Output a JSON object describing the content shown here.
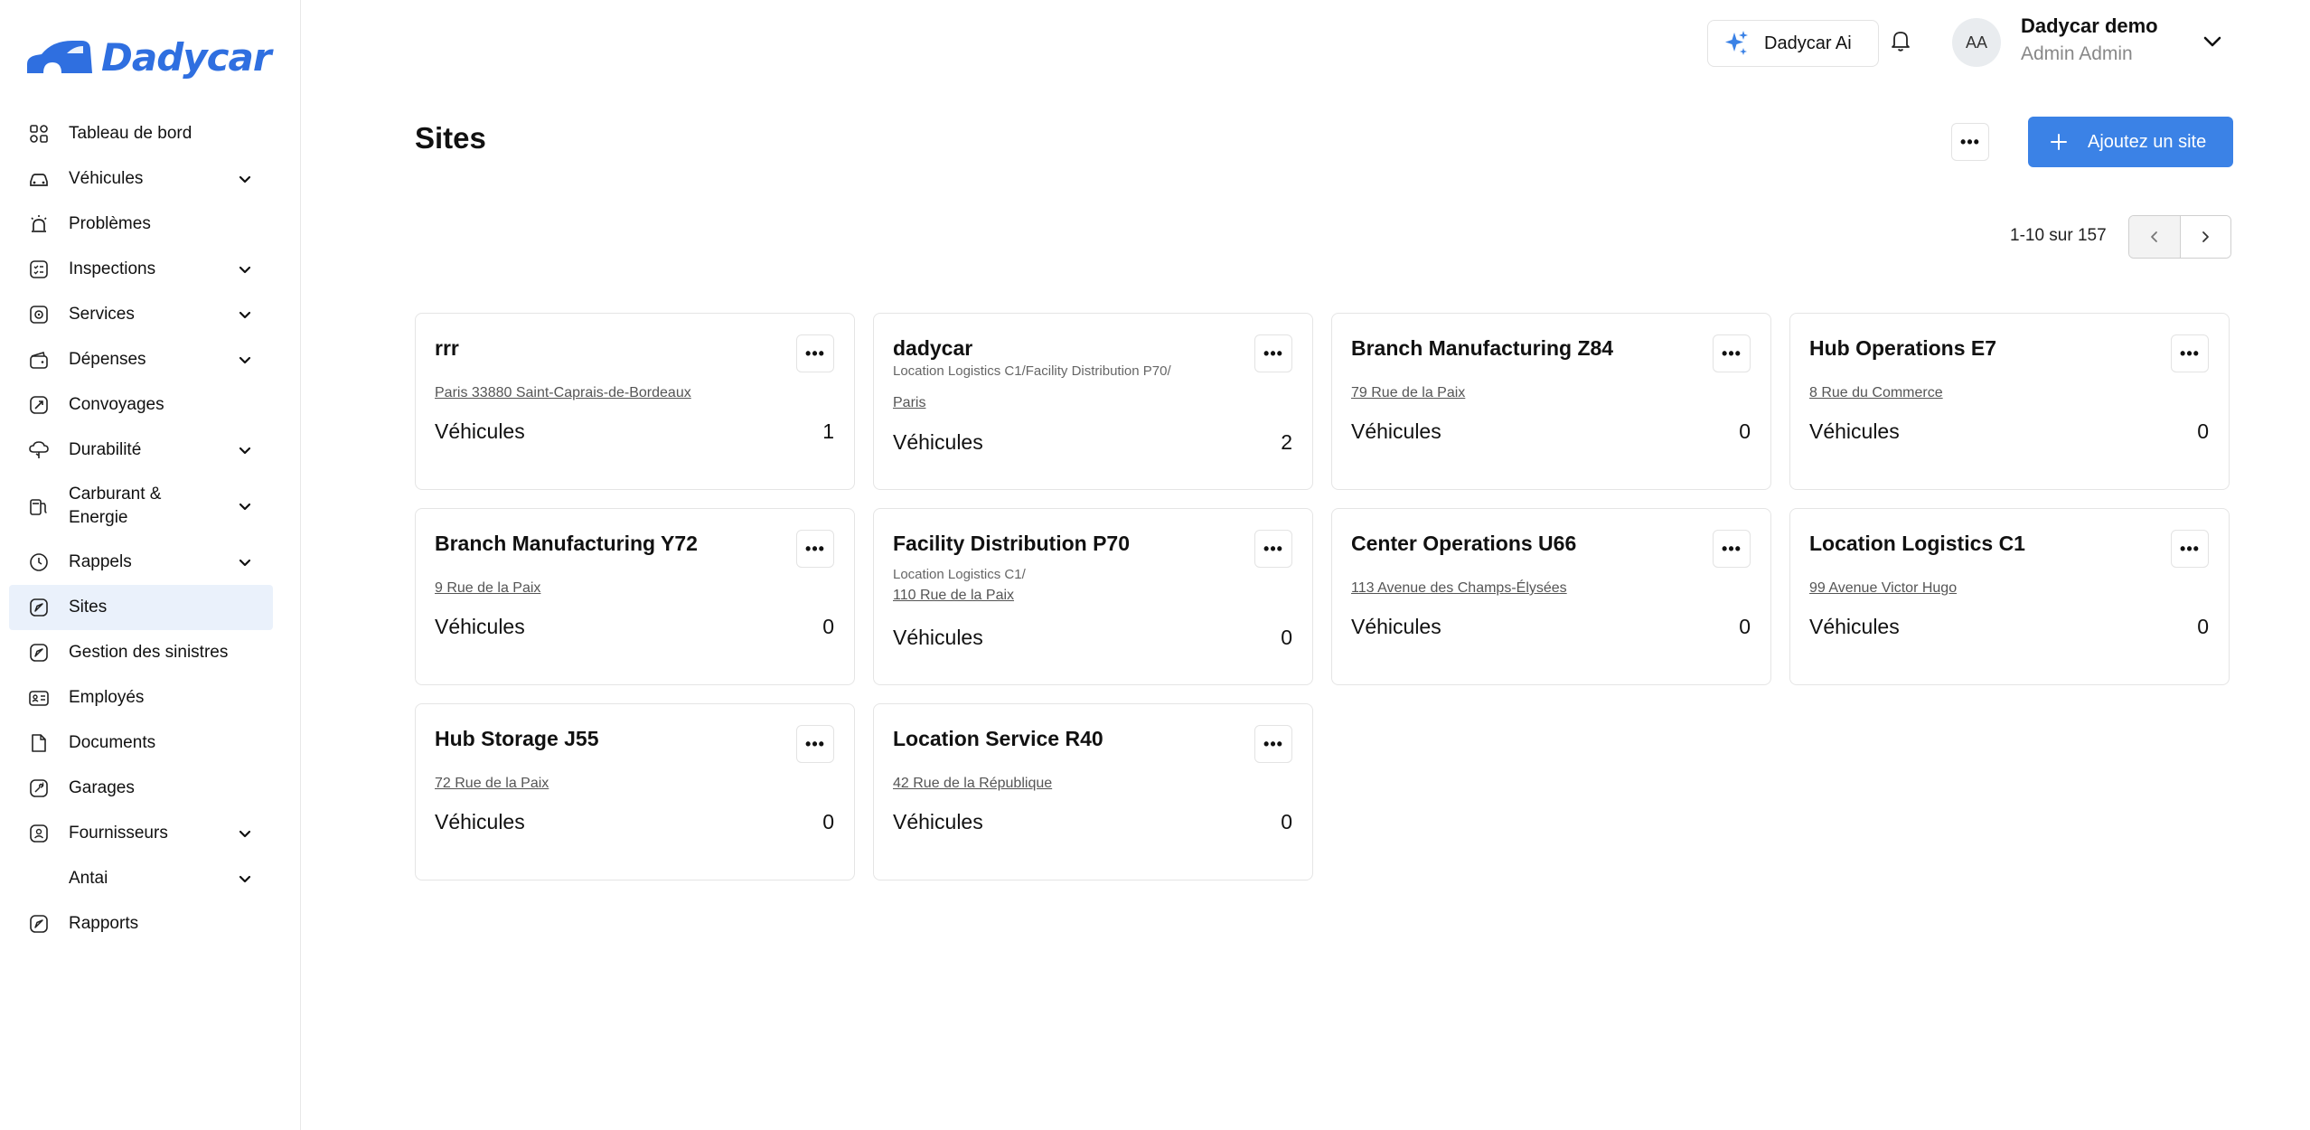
{
  "brand": {
    "name": "Dadycar"
  },
  "nav": [
    {
      "label": "Tableau de bord",
      "icon": "dashboard-icon",
      "chevron": false
    },
    {
      "label": "Véhicules",
      "icon": "car-icon",
      "chevron": true
    },
    {
      "label": "Problèmes",
      "icon": "alarm-icon",
      "chevron": false
    },
    {
      "label": "Inspections",
      "icon": "checklist-icon",
      "chevron": true
    },
    {
      "label": "Services",
      "icon": "service-icon",
      "chevron": true
    },
    {
      "label": "Dépenses",
      "icon": "wallet-icon",
      "chevron": true
    },
    {
      "label": "Convoyages",
      "icon": "route-icon",
      "chevron": false
    },
    {
      "label": "Durabilité",
      "icon": "cloud-leaf-icon",
      "chevron": true
    },
    {
      "label": "Carburant & Energie",
      "icon": "fuel-icon",
      "chevron": true
    },
    {
      "label": "Rappels",
      "icon": "clock-icon",
      "chevron": true
    },
    {
      "label": "Sites",
      "icon": "location-icon",
      "chevron": false,
      "active": true
    },
    {
      "label": "Gestion des sinistres",
      "icon": "location-icon",
      "chevron": false
    },
    {
      "label": "Employés",
      "icon": "id-card-icon",
      "chevron": false
    },
    {
      "label": "Documents",
      "icon": "document-icon",
      "chevron": false
    },
    {
      "label": "Garages",
      "icon": "wrench-icon",
      "chevron": false
    },
    {
      "label": "Fournisseurs",
      "icon": "supplier-icon",
      "chevron": true
    },
    {
      "label": "Antai",
      "icon": "",
      "chevron": true
    },
    {
      "label": "Rapports",
      "icon": "location-icon",
      "chevron": false
    }
  ],
  "topbar": {
    "ai_label": "Dadycar Ai",
    "avatar_initials": "AA",
    "user_name": "Dadycar demo",
    "user_role": "Admin Admin"
  },
  "page": {
    "title": "Sites",
    "add_label": "Ajoutez un site",
    "pagination": "1-10 sur 157"
  },
  "colors": {
    "accent": "#3b82e6",
    "logo": "#2f6fe0",
    "active_nav": "#eaf1fb"
  },
  "sites": [
    {
      "name": "rrr",
      "parent": "",
      "address": "Paris 33880 Saint-Caprais-de-Bordeaux",
      "vehicles_label": "Véhicules",
      "vehicles": "1"
    },
    {
      "name": "dadycar",
      "parent": "Location Logistics C1/Facility Distribution P70/",
      "address": "Paris",
      "vehicles_label": "Véhicules",
      "vehicles": "2"
    },
    {
      "name": "Branch Manufacturing Z84",
      "parent": "",
      "address": "79 Rue de la Paix",
      "vehicles_label": "Véhicules",
      "vehicles": "0"
    },
    {
      "name": "Hub Operations E7",
      "parent": "",
      "address": "8 Rue du Commerce",
      "vehicles_label": "Véhicules",
      "vehicles": "0"
    },
    {
      "name": "Branch Manufacturing Y72",
      "parent": "",
      "address": "9 Rue de la Paix",
      "vehicles_label": "Véhicules",
      "vehicles": "0"
    },
    {
      "name": "Facility Distribution P70",
      "parent": "Location Logistics C1/",
      "address": "110 Rue de la Paix",
      "vehicles_label": "Véhicules",
      "vehicles": "0"
    },
    {
      "name": "Center Operations U66",
      "parent": "",
      "address": "113 Avenue des Champs-Élysées",
      "vehicles_label": "Véhicules",
      "vehicles": "0"
    },
    {
      "name": "Location Logistics C1",
      "parent": "",
      "address": "99 Avenue Victor Hugo",
      "vehicles_label": "Véhicules",
      "vehicles": "0"
    },
    {
      "name": "Hub Storage J55",
      "parent": "",
      "address": "72 Rue de la Paix",
      "vehicles_label": "Véhicules",
      "vehicles": "0"
    },
    {
      "name": "Location Service R40",
      "parent": "",
      "address": "42 Rue de la République",
      "vehicles_label": "Véhicules",
      "vehicles": "0"
    }
  ]
}
